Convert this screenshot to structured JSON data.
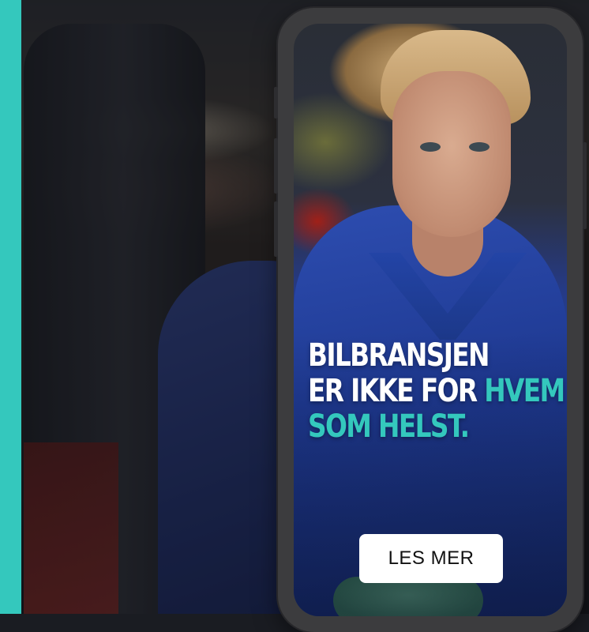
{
  "colors": {
    "accent": "#34c8bd",
    "headline_text": "#ffffff",
    "button_bg": "#ffffff",
    "button_text": "#111111"
  },
  "headline": {
    "line1": "BILBRANSJEN",
    "line2_prefix": "ER IKKE FOR ",
    "line2_highlight": "HVEM",
    "line3_highlight": "SOM HELST."
  },
  "cta": {
    "label": "LES MER"
  }
}
